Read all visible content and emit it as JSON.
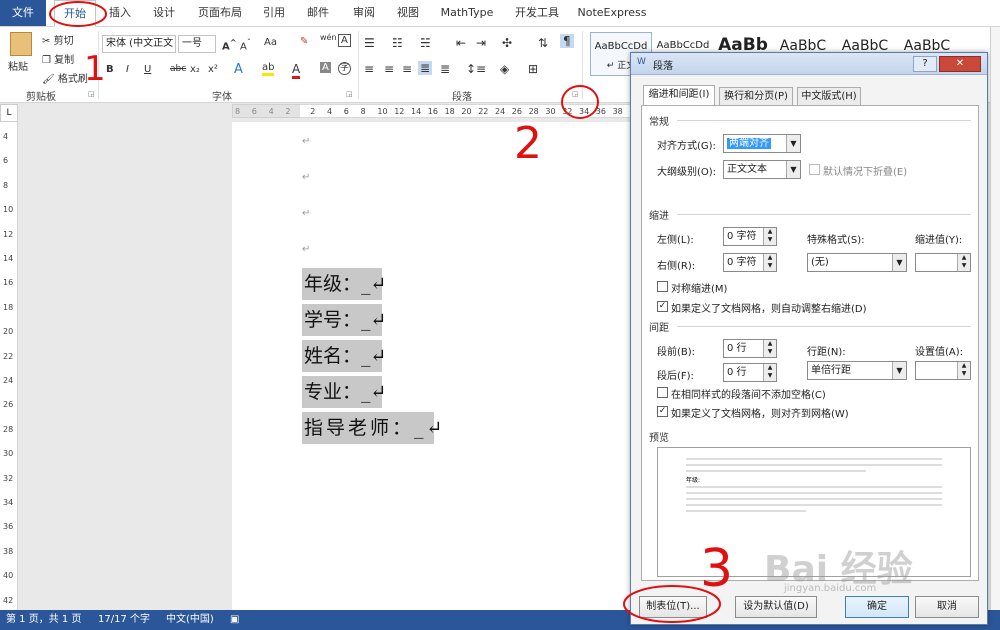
{
  "tabs": [
    {
      "label": "文件"
    },
    {
      "label": "开始"
    },
    {
      "label": "插入"
    },
    {
      "label": "设计"
    },
    {
      "label": "页面布局"
    },
    {
      "label": "引用"
    },
    {
      "label": "邮件"
    },
    {
      "label": "审阅"
    },
    {
      "label": "视图"
    },
    {
      "label": "MathType"
    },
    {
      "label": "开发工具"
    },
    {
      "label": "NoteExpress"
    }
  ],
  "ribbon": {
    "clipboard": {
      "paste": "粘贴",
      "cut": "剪切",
      "copy": "复制",
      "format_painter": "格式刷",
      "label": "剪贴板"
    },
    "font": {
      "name": "宋体 (中文正文",
      "size": "一号",
      "label": "字体",
      "change_case": "Aa",
      "pinyin": "wén",
      "char_border": "A",
      "bold": "B",
      "italic": "I",
      "underline": "U",
      "strike": "abc",
      "subscript": "x₂",
      "superscript": "x²"
    },
    "paragraph": {
      "label": "段落"
    },
    "styles": [
      {
        "label": "AaBbCcDd"
      },
      {
        "label": "AaBbCcDd"
      },
      {
        "label": "AaBb"
      },
      {
        "label": "AaBbC"
      },
      {
        "label": "AaBbC"
      },
      {
        "label": "AaBbC"
      }
    ],
    "style_sub": "↵ 正文"
  },
  "ruler": {
    "ticks": [
      "8",
      "6",
      "4",
      "2",
      "2",
      "4",
      "6",
      "8",
      "10",
      "12",
      "14",
      "16",
      "18",
      "20",
      "22",
      "24",
      "26",
      "28",
      "30",
      "32",
      "34",
      "36",
      "38"
    ]
  },
  "vruler": {
    "ticks": [
      "4",
      "6",
      "8",
      "10",
      "12",
      "14",
      "16",
      "18",
      "20",
      "22",
      "24",
      "26",
      "28",
      "30",
      "32",
      "34",
      "36",
      "38",
      "40",
      "42"
    ]
  },
  "document": {
    "para_mark": "↵",
    "fields": [
      "年级：_↵",
      "学号：_↵",
      "姓名：_↵",
      "专业：_↵",
      "指导老师：_↵"
    ]
  },
  "status": {
    "page": "第 1 页，共 1 页",
    "words": "17/17 个字",
    "lang": "中文(中国)"
  },
  "dialog": {
    "title": "段落",
    "help": "?",
    "close": "✕",
    "tabs": [
      "缩进和间距(I)",
      "换行和分页(P)",
      "中文版式(H)"
    ],
    "general": {
      "section": "常规",
      "align_label": "对齐方式(G):",
      "align_value": "两端对齐",
      "outline_label": "大纲级别(O):",
      "outline_value": "正文文本",
      "collapse_label": "默认情况下折叠(E)"
    },
    "indent": {
      "section": "缩进",
      "left_label": "左侧(L):",
      "left_value": "0 字符",
      "right_label": "右侧(R):",
      "right_value": "0 字符",
      "special_label": "特殊格式(S):",
      "special_value": "(无)",
      "by_label": "缩进值(Y):",
      "by_value": "",
      "mirror_label": "对称缩进(M)",
      "auto_label": "如果定义了文档网格，则自动调整右缩进(D)"
    },
    "spacing": {
      "section": "间距",
      "before_label": "段前(B):",
      "before_value": "0 行",
      "after_label": "段后(F):",
      "after_value": "0 行",
      "line_label": "行距(N):",
      "line_value": "单倍行距",
      "at_label": "设置值(A):",
      "at_value": "",
      "nospace_label": "在相同样式的段落间不添加空格(C)",
      "grid_label": "如果定义了文档网格，则对齐到网格(W)"
    },
    "preview": {
      "section": "预览",
      "sample": "年级:"
    },
    "buttons": {
      "tabs": "制表位(T)...",
      "default": "设为默认值(D)",
      "ok": "确定",
      "cancel": "取消"
    }
  },
  "annotations": [
    "1",
    "2",
    "3"
  ],
  "watermark": {
    "text": "Bai 经验",
    "sub": "jingyan.baidu.com"
  }
}
